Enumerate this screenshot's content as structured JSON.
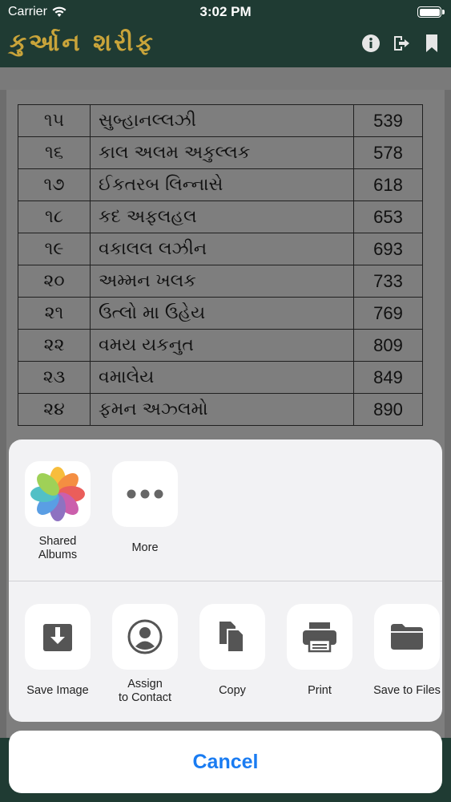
{
  "status_bar": {
    "carrier": "Carrier",
    "time": "3:02 PM"
  },
  "nav": {
    "title": "કુર્આન શરીફ",
    "icons": [
      "info-icon",
      "share-export-icon",
      "bookmark-icon"
    ]
  },
  "juz_table": [
    {
      "num": "૧૫",
      "name": "સુબ્હાનલ્લઝી",
      "page": "539"
    },
    {
      "num": "૧૬",
      "name": "કાલ અલમ અકુલ્લક",
      "page": "578"
    },
    {
      "num": "૧૭",
      "name": "ઈકતરબ લિન્નાસે",
      "page": "618"
    },
    {
      "num": "૧૮",
      "name": "કદ અફલહલ",
      "page": "653"
    },
    {
      "num": "૧૯",
      "name": "વકાલલ લઝીન",
      "page": "693"
    },
    {
      "num": "૨૦",
      "name": "અમ્મન ખલક",
      "page": "733"
    },
    {
      "num": "૨૧",
      "name": "ઉત્લો મા ઉહેય",
      "page": "769"
    },
    {
      "num": "૨૨",
      "name": "વમય યકનુત",
      "page": "809"
    },
    {
      "num": "૨૩",
      "name": "વમાલેય",
      "page": "849"
    },
    {
      "num": "૨૪",
      "name": "ફમન અઝ્લમો",
      "page": "890"
    }
  ],
  "share_sheet": {
    "apps": [
      {
        "label": "Shared Albums",
        "label_line1": "Shared",
        "label_line2": "Albums",
        "icon": "photos-icon"
      },
      {
        "label": "More",
        "icon": "more-dots-icon"
      }
    ],
    "actions": [
      {
        "label": "Save Image",
        "icon": "save-image-icon"
      },
      {
        "label_line1": "Assign",
        "label_line2": "to Contact",
        "icon": "contact-icon"
      },
      {
        "label": "Copy",
        "icon": "copy-icon"
      },
      {
        "label": "Print",
        "icon": "print-icon"
      },
      {
        "label": "Save to Files",
        "icon": "folder-icon"
      }
    ],
    "cancel_label": "Cancel"
  },
  "colors": {
    "bar": "#1f3b33",
    "title_gold": "#c9a43a",
    "cancel_blue": "#1a7cf2"
  }
}
